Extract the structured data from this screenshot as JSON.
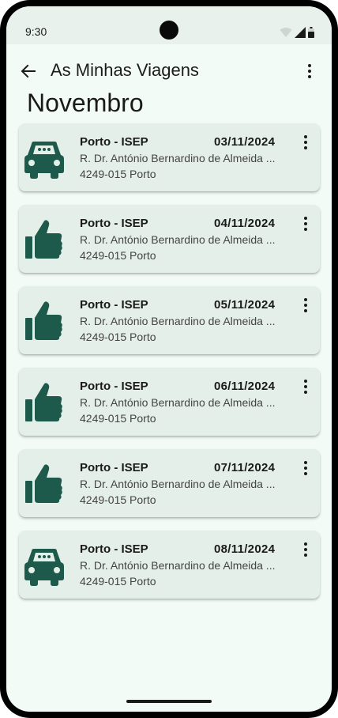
{
  "status_bar": {
    "time": "9:30"
  },
  "app_bar": {
    "title": "As Minhas Viagens"
  },
  "month_title": "Novembro",
  "trips": [
    {
      "name": "Porto - ISEP",
      "date": "03/11/2024",
      "address_line1": "R. Dr. António Bernardino de Almeida ...",
      "address_line2": "4249-015 Porto",
      "icon": "car-icon"
    },
    {
      "name": "Porto - ISEP",
      "date": "04/11/2024",
      "address_line1": "R. Dr. António Bernardino de Almeida ...",
      "address_line2": "4249-015 Porto",
      "icon": "thumbs-up-icon"
    },
    {
      "name": "Porto - ISEP",
      "date": "05/11/2024",
      "address_line1": "R. Dr. António Bernardino de Almeida ...",
      "address_line2": "4249-015 Porto",
      "icon": "thumbs-up-icon"
    },
    {
      "name": "Porto - ISEP",
      "date": "06/11/2024",
      "address_line1": "R. Dr. António Bernardino de Almeida ...",
      "address_line2": "4249-015 Porto",
      "icon": "thumbs-up-icon"
    },
    {
      "name": "Porto - ISEP",
      "date": "07/11/2024",
      "address_line1": "R. Dr. António Bernardino de Almeida ...",
      "address_line2": "4249-015 Porto",
      "icon": "thumbs-up-icon"
    },
    {
      "name": "Porto - ISEP",
      "date": "08/11/2024",
      "address_line1": "R. Dr. António Bernardino de Almeida ...",
      "address_line2": "4249-015 Porto",
      "icon": "car-icon"
    }
  ],
  "colors": {
    "accent": "#1e5a4c",
    "background": "#f3fbf6",
    "card": "#e4efe9"
  }
}
